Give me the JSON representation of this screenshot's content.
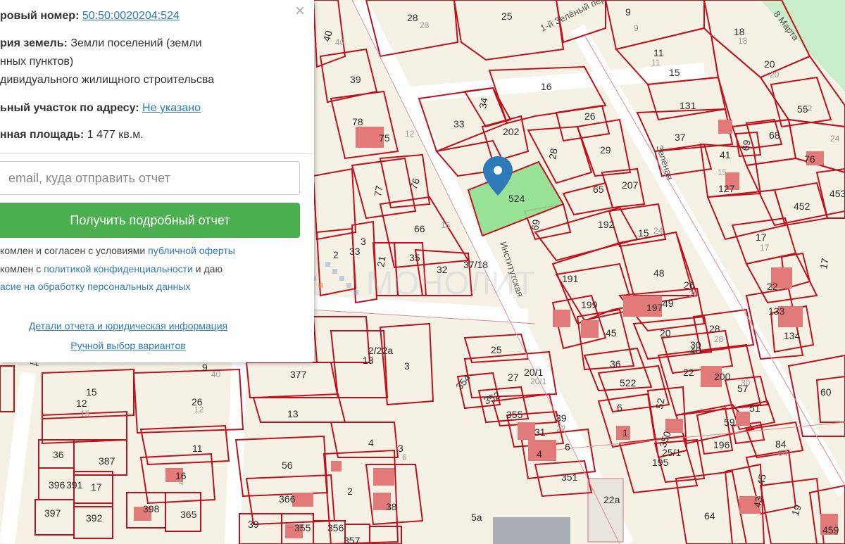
{
  "panel": {
    "cadastral_label": "ровый номер:",
    "cadastral_value": "50:50:0020204:524",
    "category_label": "рия земель:",
    "category_value": "Земли поселений (земли",
    "category_cont1": "нных пунктов)",
    "category_cont2": "дивидуального жилищного строительсва",
    "address_label": "ьный участок по адресу:",
    "address_value": "Не указано",
    "area_label": "нная площадь:",
    "area_value": "1 477 кв.м.",
    "email_placeholder": " email, куда отправить отчет",
    "get_report_button": "Получить подробный отчет",
    "agree1_text": "комлен и согласен с условиями ",
    "agree1_link": "публичной оферты",
    "agree2_text": "комлен с ",
    "agree2_link": "политикой конфиденциальности",
    "agree2_tail": " и даю",
    "agree3_link": "асие на обработку персональных данных",
    "details_link": "Детали отчета и юридическая информация",
    "manual_link": "Ручной выбор вариантов",
    "close_glyph": "×"
  },
  "map": {
    "watermark": "МОНОЛИТ",
    "selected_parcel": "524",
    "streets": [
      {
        "text": "8 Марта"
      },
      {
        "text": "1-й Зелёный пер."
      },
      {
        "text": "Зелёная"
      },
      {
        "text": "Институтская"
      },
      {
        "text": "Де"
      }
    ],
    "parcel_labels": [
      "28",
      "25",
      "9",
      "18",
      "40",
      "11",
      "20",
      "15",
      "39",
      "16",
      "131",
      "55",
      "78",
      "75",
      "33",
      "34",
      "202",
      "26",
      "37",
      "68",
      "29",
      "69",
      "41",
      "28",
      "76",
      "207",
      "127",
      "453",
      "77",
      "76",
      "65",
      "452",
      "66",
      "192",
      "15",
      "17",
      "524",
      "69",
      "2",
      "33",
      "3",
      "21",
      "35",
      "32",
      "37/18",
      "191",
      "48",
      "17",
      "22",
      "199",
      "197",
      "49",
      "26",
      "133",
      "134",
      "13",
      "2/22a",
      "3",
      "25",
      "45",
      "20",
      "28",
      "40",
      "9",
      "377",
      "15",
      "12",
      "26",
      "27",
      "36",
      "30",
      "22",
      "200",
      "354",
      "352",
      "355",
      "20/1",
      "522",
      "57",
      "13",
      "4",
      "11",
      "3",
      "6",
      "1",
      "52",
      "51",
      "59",
      "60",
      "31",
      "39",
      "6",
      "350",
      "196",
      "56",
      "16",
      "4",
      "36",
      "387",
      "396",
      "391",
      "17",
      "397",
      "392",
      "398",
      "365",
      "366",
      "2",
      "38",
      "39",
      "355",
      "356",
      "357",
      "351",
      "195",
      "25/1",
      "64",
      "43",
      "45",
      "19",
      "459",
      "22a",
      "5a",
      "84"
    ],
    "faint_labels": [
      "28",
      "9",
      "18",
      "20",
      "22",
      "24",
      "40",
      "11",
      "12",
      "15",
      "16",
      "17",
      "24",
      "26",
      "28",
      "30",
      "40",
      "20/1",
      "22",
      "6",
      "15",
      "12",
      "4",
      "84"
    ]
  }
}
